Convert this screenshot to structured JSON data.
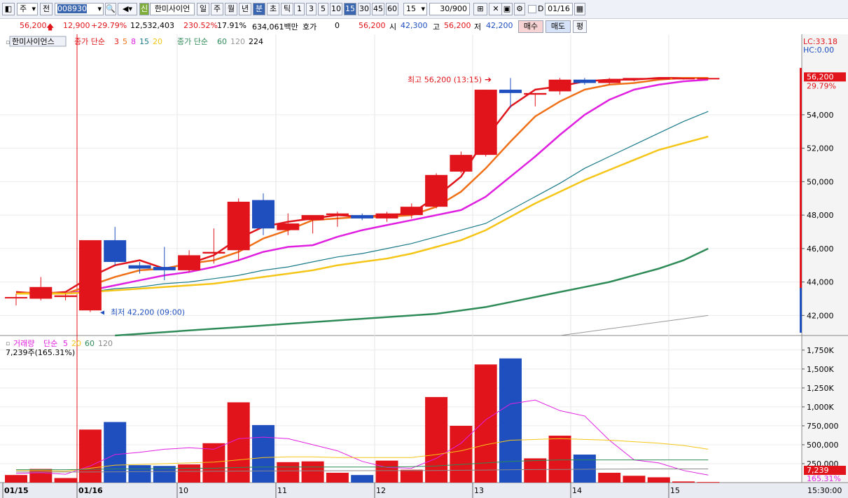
{
  "toolbar": {
    "period_select": "주",
    "prev_label": "전",
    "code_input": "008930",
    "new_badge": "신",
    "stock_name": "한미사이언",
    "periods": [
      "일",
      "주",
      "월",
      "년",
      "분",
      "초",
      "틱"
    ],
    "intervals": [
      "1",
      "3",
      "5",
      "10",
      "15",
      "30",
      "45",
      "60"
    ],
    "interval_select": "15",
    "count": "30/900",
    "checkbox_label": "D",
    "date": "01/16"
  },
  "quote": {
    "price": "56,200",
    "change": "12,900",
    "change_pct": "+29.79%",
    "volume": "12,532,403",
    "volume_ratio": "230.52%",
    "turnover": "17.91%",
    "amount": "634,061백만",
    "hoga_label": "호가",
    "hoga_value": "0",
    "hoga_price": "56,200",
    "open_label": "시",
    "open": "42,300",
    "high_label": "고",
    "high": "56,200",
    "low_label": "저",
    "low": "42,200",
    "buy_label": "매수",
    "sell_label": "매도",
    "avg_label": "평"
  },
  "price_panel": {
    "name_box": "한미사이언스",
    "ma1_label": "종가 단순",
    "ma1_periods": [
      {
        "p": "3",
        "color": "#e0141a"
      },
      {
        "p": "5",
        "color": "#f07018"
      },
      {
        "p": "8",
        "color": "#e020e0"
      },
      {
        "p": "15",
        "color": "#1a7a8a"
      },
      {
        "p": "20",
        "color": "#f5c518"
      }
    ],
    "ma2_label": "종가 단순",
    "ma2_periods": [
      {
        "p": "60",
        "color": "#2e8b57"
      },
      {
        "p": "120",
        "color": "#999999"
      },
      {
        "p": "224",
        "color": "#000000"
      }
    ],
    "lc": "LC:33.18",
    "hc": "HC:0.00",
    "high_note": "최고 56,200 (13:15)",
    "low_note": "최저 42,200 (09:00)",
    "last_price_tag": "56,200",
    "last_pct": "29.79%",
    "y_ticks": [
      "54,000",
      "52,000",
      "50,000",
      "48,000",
      "46,000",
      "44,000",
      "42,000"
    ]
  },
  "volume_panel": {
    "title": "거래량",
    "ma_label": "단순",
    "ma_periods": [
      {
        "p": "5",
        "color": "#e020e0"
      },
      {
        "p": "20",
        "color": "#f5c518"
      },
      {
        "p": "60",
        "color": "#2e8b57"
      },
      {
        "p": "120",
        "color": "#888888"
      }
    ],
    "current": "7,239주(165.31%)",
    "last_tag": "7,239",
    "last_pct": "165.31%",
    "y_ticks": [
      "1,750K",
      "1,500K",
      "1,250K",
      "1,000K",
      "750,000",
      "500,000",
      "250,000"
    ]
  },
  "x_axis": {
    "labels": [
      "01/15",
      "01/16",
      "10",
      "11",
      "12",
      "13",
      "14",
      "15"
    ],
    "time_label": "15:30:00"
  },
  "chart_data": {
    "type": "candlestick",
    "ylim": [
      40800,
      56800
    ],
    "volume_ylim": [
      0,
      1850000
    ],
    "candles": [
      {
        "o": 43100,
        "h": 43300,
        "l": 42600,
        "c": 43100,
        "v": 100000
      },
      {
        "o": 43000,
        "h": 44300,
        "l": 42900,
        "c": 43700,
        "v": 180000
      },
      {
        "o": 43100,
        "h": 43300,
        "l": 42900,
        "c": 43200,
        "v": 60000
      },
      {
        "o": 42300,
        "h": 46500,
        "l": 42200,
        "c": 46500,
        "v": 700000
      },
      {
        "o": 46500,
        "h": 47300,
        "l": 45000,
        "c": 45200,
        "v": 800000
      },
      {
        "o": 45000,
        "h": 45200,
        "l": 44500,
        "c": 44800,
        "v": 230000
      },
      {
        "o": 44900,
        "h": 46100,
        "l": 44100,
        "c": 44700,
        "v": 220000
      },
      {
        "o": 44700,
        "h": 45900,
        "l": 44600,
        "c": 45600,
        "v": 240000
      },
      {
        "o": 45700,
        "h": 47200,
        "l": 45100,
        "c": 45800,
        "v": 520000
      },
      {
        "o": 45900,
        "h": 49000,
        "l": 45300,
        "c": 48800,
        "v": 1060000
      },
      {
        "o": 48900,
        "h": 49300,
        "l": 46800,
        "c": 47200,
        "v": 760000
      },
      {
        "o": 47100,
        "h": 48100,
        "l": 46800,
        "c": 47500,
        "v": 270000
      },
      {
        "o": 47700,
        "h": 48000,
        "l": 46900,
        "c": 48000,
        "v": 280000
      },
      {
        "o": 48000,
        "h": 48200,
        "l": 47300,
        "c": 48100,
        "v": 130000
      },
      {
        "o": 48000,
        "h": 48100,
        "l": 47700,
        "c": 47800,
        "v": 100000
      },
      {
        "o": 47800,
        "h": 48200,
        "l": 47600,
        "c": 48100,
        "v": 290000
      },
      {
        "o": 48000,
        "h": 48700,
        "l": 47800,
        "c": 48500,
        "v": 170000
      },
      {
        "o": 48500,
        "h": 50500,
        "l": 48400,
        "c": 50400,
        "v": 1130000
      },
      {
        "o": 50600,
        "h": 51800,
        "l": 50500,
        "c": 51600,
        "v": 750000
      },
      {
        "o": 51600,
        "h": 55500,
        "l": 51500,
        "c": 55500,
        "v": 1560000
      },
      {
        "o": 55500,
        "h": 56200,
        "l": 54400,
        "c": 55300,
        "v": 1640000
      },
      {
        "o": 55200,
        "h": 55300,
        "l": 54500,
        "c": 55300,
        "v": 320000
      },
      {
        "o": 55400,
        "h": 56200,
        "l": 55200,
        "c": 56100,
        "v": 620000
      },
      {
        "o": 56100,
        "h": 56200,
        "l": 55800,
        "c": 55900,
        "v": 370000
      },
      {
        "o": 55900,
        "h": 56200,
        "l": 55800,
        "c": 56100,
        "v": 130000
      },
      {
        "o": 56200,
        "h": 56200,
        "l": 56000,
        "c": 56200,
        "v": 90000
      },
      {
        "o": 56200,
        "h": 56200,
        "l": 56100,
        "c": 56200,
        "v": 70000
      },
      {
        "o": 56200,
        "h": 56200,
        "l": 56100,
        "c": 56200,
        "v": 15000
      },
      {
        "o": 56200,
        "h": 56200,
        "l": 56200,
        "c": 56200,
        "v": 7239
      }
    ],
    "ma_lines": [
      {
        "p": "3",
        "color": "#e0141a",
        "w": 2.5,
        "values": [
          43400,
          43300,
          43400,
          44300,
          45000,
          45300,
          44800,
          45100,
          45600,
          46600,
          47300,
          47600,
          47800,
          48000,
          47900,
          48000,
          48100,
          49100,
          50300,
          52600,
          54500,
          55500,
          55700,
          56000,
          56100,
          56100,
          56200,
          56200,
          56200
        ]
      },
      {
        "p": "5",
        "color": "#f07018",
        "w": 2.5,
        "values": [
          43300,
          43400,
          43300,
          43800,
          44300,
          44700,
          44800,
          45100,
          45300,
          45800,
          46600,
          47100,
          47700,
          47800,
          47900,
          47900,
          48000,
          48500,
          49400,
          50800,
          52400,
          53900,
          54800,
          55500,
          55800,
          55900,
          56100,
          56200,
          56200
        ]
      },
      {
        "p": "8",
        "color": "#e020e0",
        "w": 2.5,
        "values": [
          43300,
          43300,
          43300,
          43500,
          43800,
          44100,
          44400,
          44600,
          44900,
          45300,
          45800,
          46100,
          46200,
          46700,
          47100,
          47400,
          47700,
          48000,
          48300,
          49100,
          50300,
          51500,
          52800,
          54000,
          54900,
          55500,
          55800,
          56000,
          56100
        ]
      },
      {
        "p": "15",
        "color": "#1a7a8a",
        "w": 1.2,
        "values": [
          43300,
          43300,
          43300,
          43400,
          43600,
          43700,
          43900,
          44000,
          44200,
          44400,
          44700,
          44900,
          45200,
          45500,
          45700,
          46000,
          46300,
          46700,
          47100,
          47500,
          48300,
          49100,
          49900,
          50800,
          51500,
          52200,
          52900,
          53600,
          54200
        ]
      },
      {
        "p": "20",
        "color": "#f5c518",
        "w": 2.5,
        "values": [
          43300,
          43300,
          43300,
          43400,
          43500,
          43600,
          43700,
          43800,
          43900,
          44100,
          44300,
          44500,
          44700,
          45000,
          45200,
          45400,
          45700,
          46100,
          46500,
          47100,
          47900,
          48700,
          49400,
          50100,
          50700,
          51300,
          51900,
          52300,
          52700
        ]
      },
      {
        "p": "60",
        "color": "#2e8b57",
        "w": 2.5,
        "values": [
          null,
          null,
          null,
          null,
          40800,
          40900,
          41000,
          41100,
          41200,
          41300,
          41400,
          41500,
          41600,
          41700,
          41800,
          41900,
          42000,
          42100,
          42300,
          42500,
          42800,
          43100,
          43400,
          43700,
          44000,
          44400,
          44800,
          45300,
          46000
        ]
      },
      {
        "p": "120",
        "color": "#999999",
        "w": 1,
        "values": [
          null,
          null,
          null,
          null,
          null,
          null,
          null,
          null,
          null,
          null,
          null,
          null,
          null,
          null,
          null,
          null,
          null,
          null,
          null,
          null,
          null,
          null,
          40800,
          41000,
          41200,
          41400,
          41600,
          41800,
          42000
        ]
      }
    ],
    "vol_ma_lines": [
      {
        "p": "5",
        "color": "#e020e0",
        "values": [
          120000,
          130000,
          110000,
          220000,
          370000,
          400000,
          440000,
          460000,
          440000,
          580000,
          600000,
          580000,
          500000,
          420000,
          280000,
          200000,
          190000,
          320000,
          520000,
          830000,
          1040000,
          1090000,
          950000,
          880000,
          560000,
          300000,
          260000,
          160000,
          100000
        ]
      },
      {
        "p": "20",
        "color": "#f5c518",
        "values": [
          160000,
          160000,
          150000,
          190000,
          230000,
          240000,
          250000,
          260000,
          270000,
          300000,
          330000,
          340000,
          340000,
          330000,
          330000,
          330000,
          330000,
          370000,
          420000,
          500000,
          560000,
          570000,
          580000,
          570000,
          560000,
          540000,
          520000,
          490000,
          440000
        ]
      },
      {
        "p": "60",
        "color": "#2e8b57",
        "values": [
          170000,
          170000,
          170000,
          175000,
          180000,
          180000,
          185000,
          190000,
          190000,
          200000,
          205000,
          205000,
          205000,
          205000,
          205000,
          205000,
          210000,
          220000,
          240000,
          260000,
          280000,
          290000,
          300000,
          300000,
          300000,
          300000,
          300000,
          300000,
          300000
        ]
      },
      {
        "p": "120",
        "color": "#888888",
        "values": [
          140000,
          140000,
          140000,
          140000,
          142000,
          144000,
          146000,
          148000,
          150000,
          152000,
          154000,
          155000,
          156000,
          156000,
          157000,
          158000,
          158000,
          160000,
          163000,
          166000,
          170000,
          172000,
          174000,
          176000,
          178000,
          179000,
          180000,
          180000,
          180000
        ]
      }
    ],
    "title": "한미사이언스"
  }
}
